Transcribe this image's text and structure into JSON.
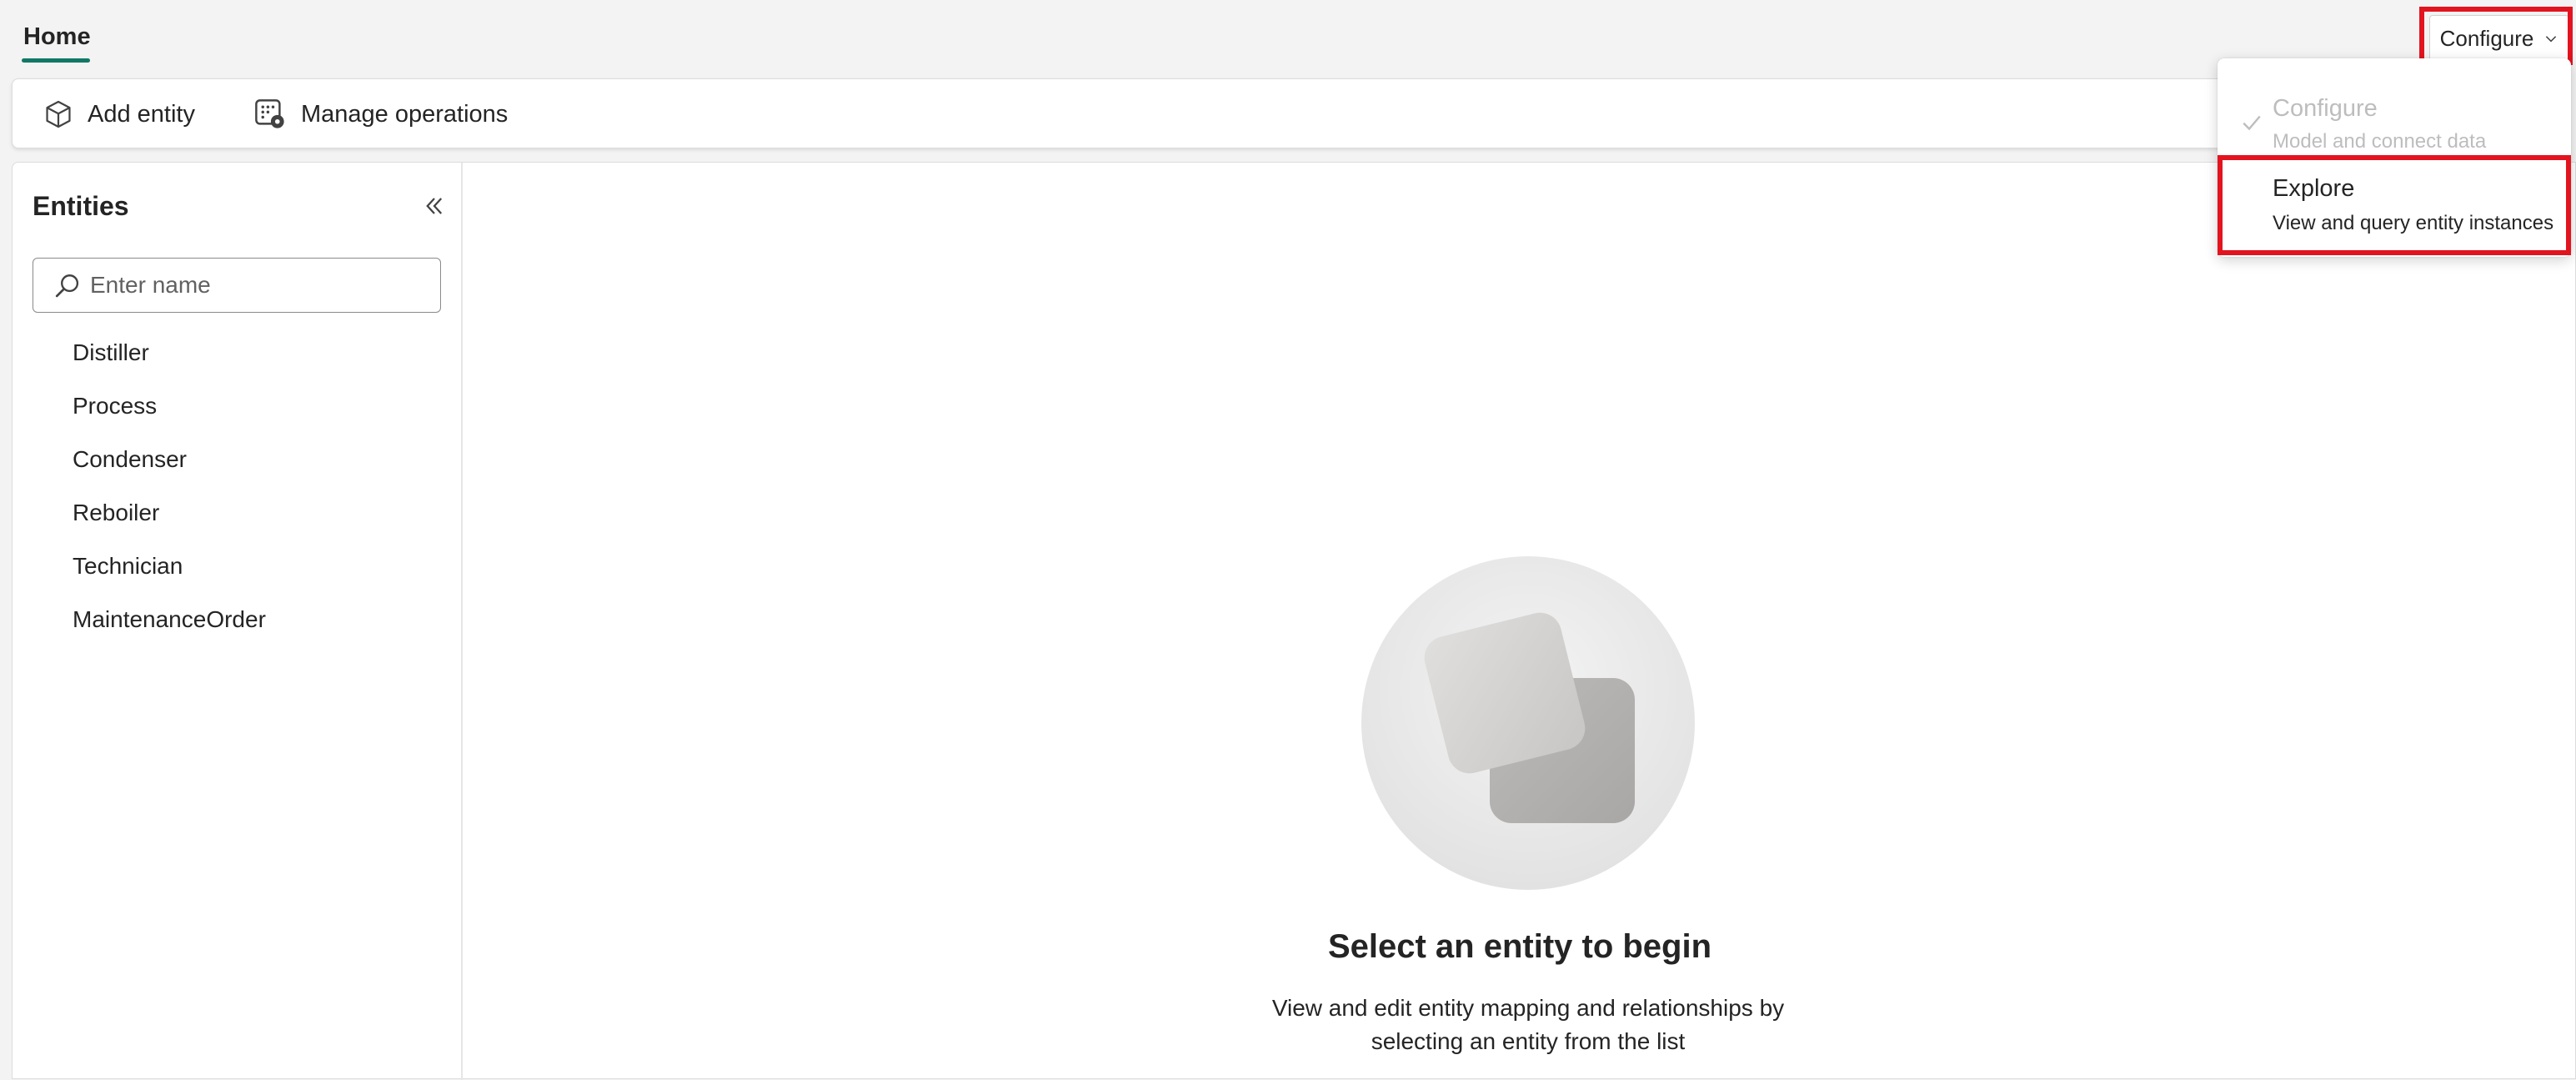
{
  "tabs": {
    "home": "Home"
  },
  "mode_button": {
    "label": "Configure"
  },
  "toolbar": {
    "add_entity": "Add entity",
    "manage_operations": "Manage operations"
  },
  "sidebar": {
    "title": "Entities",
    "search_placeholder": "Enter name",
    "items": [
      "Distiller",
      "Process",
      "Condenser",
      "Reboiler",
      "Technician",
      "MaintenanceOrder"
    ]
  },
  "empty_state": {
    "title": "Select an entity to begin",
    "description": "View and edit entity mapping and relationships by selecting an entity from the list"
  },
  "dropdown": {
    "configure": {
      "label": "Configure",
      "sublabel": "Model and connect data",
      "selected": true
    },
    "explore": {
      "label": "Explore",
      "sublabel": "View and query entity instances",
      "selected": false
    }
  },
  "colors": {
    "accent": "#117865",
    "highlight": "#e2141f"
  }
}
